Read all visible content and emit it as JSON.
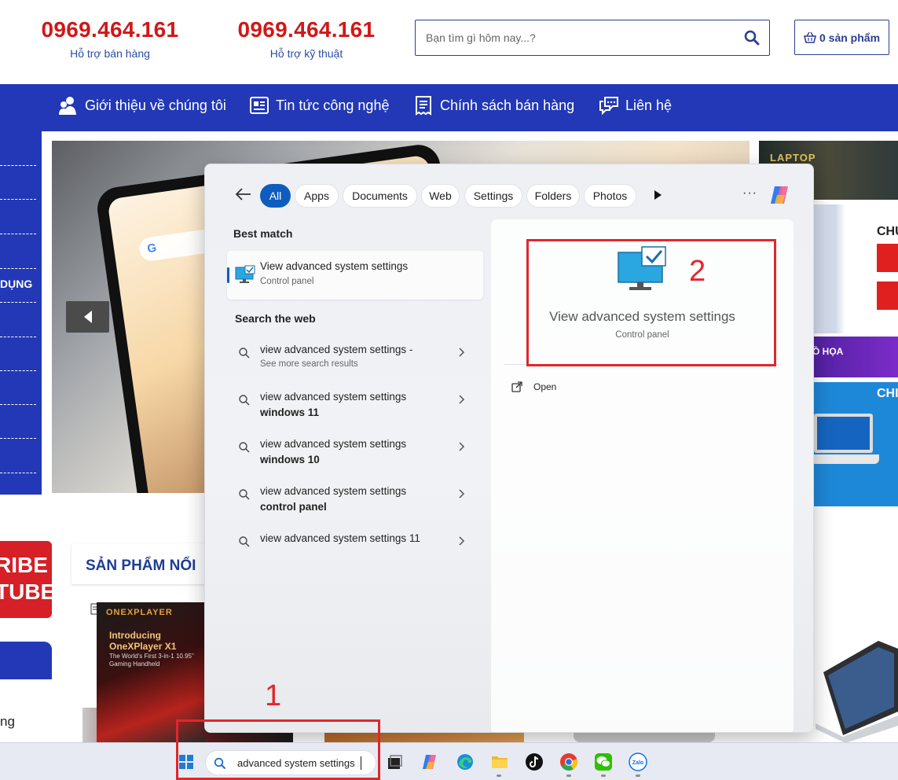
{
  "header": {
    "hotlines": [
      {
        "number": "0969.464.161",
        "label": "Hỗ trợ bán hàng"
      },
      {
        "number": "0969.464.161",
        "label": "Hỗ trợ kỹ thuật"
      }
    ],
    "search_placeholder": "Bạn tìm gì hôm nay...?",
    "cart_label": "0 sản phẩm"
  },
  "nav": {
    "items": [
      {
        "label": "Giới thiệu về chúng tôi",
        "icon": "users-icon"
      },
      {
        "label": "Tin tức công nghệ",
        "icon": "news-icon"
      },
      {
        "label": "Chính sách bán hàng",
        "icon": "receipt-icon"
      },
      {
        "label": "Liên hệ",
        "icon": "chat-icon"
      }
    ]
  },
  "sidebar": {
    "partial_label": "DỤNG",
    "bottom_label": "ng"
  },
  "banners": {
    "laptop_label": "LAPTOP",
    "chu1": "CHU",
    "chu2": "CHI",
    "do_hoa": "Ồ HỌA"
  },
  "youtube": {
    "line1": "RIBE",
    "line2": "TUBE"
  },
  "featured": {
    "title": "SẢN PHẨM NỔI",
    "product_brand": "ONEXPLAYER",
    "product_intro_1": "Introducing",
    "product_intro_2": "OneXPlayer X1",
    "product_tagline": "The World's First 3-in-1 10.95\" Gaming Handheld"
  },
  "start_search": {
    "filters": [
      {
        "label": "All",
        "active": true
      },
      {
        "label": "Apps",
        "active": false
      },
      {
        "label": "Documents",
        "active": false
      },
      {
        "label": "Web",
        "active": false
      },
      {
        "label": "Settings",
        "active": false
      },
      {
        "label": "Folders",
        "active": false
      },
      {
        "label": "Photos",
        "active": false
      }
    ],
    "more_label": "···",
    "best_match_heading": "Best match",
    "best_match": {
      "title": "View advanced system settings",
      "subtitle": "Control panel"
    },
    "web_heading": "Search the web",
    "web_results": [
      {
        "line1": "view advanced system settings -",
        "line2": "See more search results"
      },
      {
        "line1": "view advanced system settings",
        "line2": "windows 11"
      },
      {
        "line1": "view advanced system settings",
        "line2": "windows 10"
      },
      {
        "line1": "view advanced system settings",
        "line2": "control panel"
      },
      {
        "line1": "view advanced system settings 11",
        "line2": ""
      }
    ],
    "detail": {
      "title": "View advanced system settings",
      "subtitle": "Control panel",
      "open_label": "Open"
    }
  },
  "taskbar": {
    "search_text": "advanced system settings",
    "icons": [
      "windows-start-icon",
      "task-view-icon",
      "copilot-icon",
      "edge-icon",
      "file-explorer-icon",
      "tiktok-icon",
      "chrome-icon",
      "wechat-icon",
      "zalo-icon"
    ],
    "zalo_label": "Zalo"
  },
  "annotations": {
    "step1": "1",
    "step2": "2",
    "color": "#e0272c"
  },
  "colors": {
    "hotline_red": "#d01818",
    "nav_blue": "#2238b6",
    "windows_accent": "#0f5cbf"
  }
}
